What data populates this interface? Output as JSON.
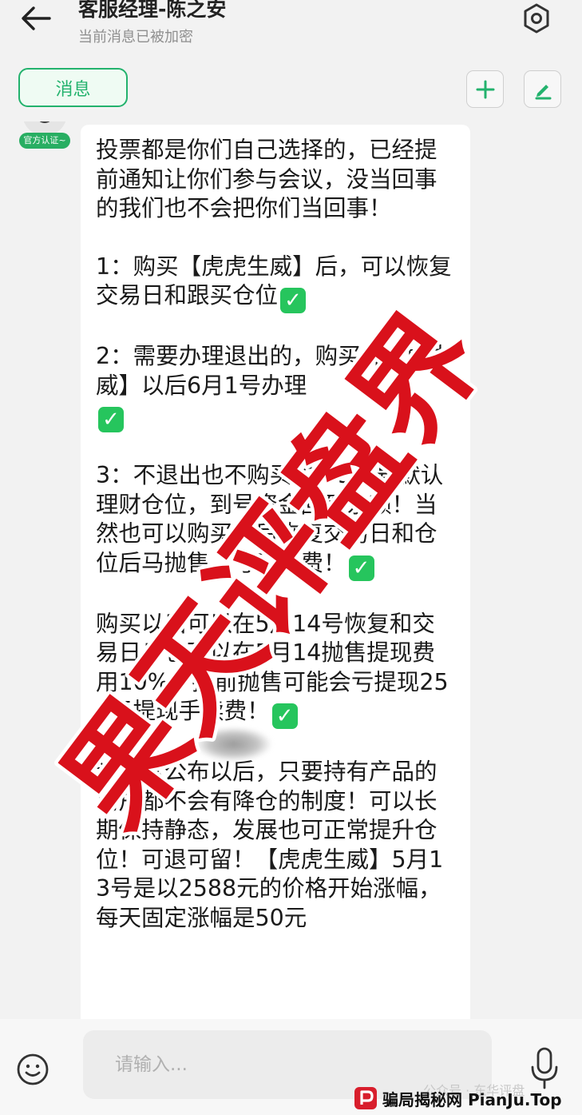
{
  "header": {
    "title": "客服经理-陈之安",
    "subtitle": "当前消息已被加密",
    "tab_label": "消息"
  },
  "message": {
    "badge": "官方认证~",
    "paragraphs": [
      "投票都是你们自己选择的，已经提前通知让你们参与会议，没当回事的我们也不会把你们当回事！",
      "1：购买【虎虎生威】后，可以恢复交易日和跟买仓位",
      "2：需要办理退出的，购买【虎虎生威】以后6月1号办理",
      "3：不退出也不购买的，5月号默认理财仓位，到号资金回到余额！当然也可以购买以后恢复交易日和仓位后马抛售，亏手续费！",
      "购买以后可以在5月14号恢复和交易日！也可以在5月14抛售提现费用10%，提前抛售可能会亏提现259元提现手续费！",
      "该制度公布以后，只要持有产品的用户都不会有降仓的制度！可以长期保持静态，发展也可正常提升仓位！可退可留！【虎虎生威】5月13号是以2588元的价格开始涨幅，每天固定涨幅是50元"
    ],
    "check_glyph": "✓"
  },
  "watermark": {
    "text": "果天评盘界",
    "color": "#d9111b"
  },
  "input_bar": {
    "placeholder": "请输入..."
  },
  "footer": {
    "caption": "公众号 · 东华评盘",
    "brand_text": "骗局揭秘网 PianJu.Top"
  },
  "colors": {
    "accent": "#23b26d",
    "check": "#26c55d"
  }
}
